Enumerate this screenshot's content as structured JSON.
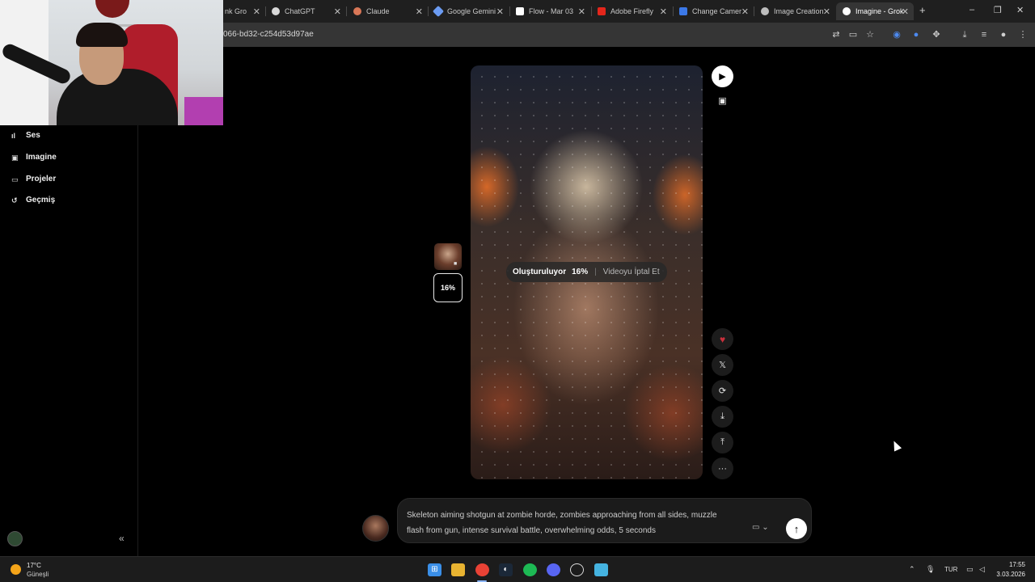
{
  "browser": {
    "tabs": [
      {
        "title": "nk Gro",
        "icon": "grok-icon",
        "color": "#9e9e9e"
      },
      {
        "title": "ChatGPT",
        "icon": "chatgpt-icon",
        "color": "#d9d9d9"
      },
      {
        "title": "Claude",
        "icon": "claude-icon",
        "color": "#d97757"
      },
      {
        "title": "Google Gemini",
        "icon": "gemini-icon",
        "color": "#6b9bf2"
      },
      {
        "title": "Flow - Mar 03",
        "icon": "flow-icon",
        "color": "#ffffff"
      },
      {
        "title": "Adobe Firefly",
        "icon": "firefly-icon",
        "color": "#e4261b"
      },
      {
        "title": "Change Camer",
        "icon": "docs-icon",
        "color": "#3b78e7"
      },
      {
        "title": "Image Creation",
        "icon": "grok-icon",
        "color": "#bdbdbd"
      },
      {
        "title": "Imagine - Grok",
        "icon": "grok-icon",
        "color": "#ffffff"
      }
    ],
    "active_tab": 8,
    "url": "066-bd32-c254d53d97ae",
    "new_tab_symbol": "+",
    "window_controls": [
      "–",
      "❐",
      "✕"
    ]
  },
  "sidebar": {
    "items": [
      {
        "label": "Ses",
        "icon": "audio-waveform-icon"
      },
      {
        "label": "Imagine",
        "icon": "imagine-icon"
      },
      {
        "label": "Projeler",
        "icon": "folder-icon"
      },
      {
        "label": "Geçmiş",
        "icon": "history-icon"
      }
    ],
    "collapse_symbol": "«"
  },
  "generation": {
    "status_label": "Oluşturuluyor",
    "progress": "16%",
    "progress_fraction": 0.16,
    "cancel_label": "Videoyu İptal Et",
    "thumbnail_progress": "16%"
  },
  "actions": [
    {
      "name": "video-mode-icon",
      "glyph": "▶"
    },
    {
      "name": "image-mode-icon",
      "glyph": "▣"
    },
    {
      "name": "heart-icon",
      "glyph": "♥"
    },
    {
      "name": "x-share-icon",
      "glyph": "𝕏"
    },
    {
      "name": "remix-icon",
      "glyph": "⟳"
    },
    {
      "name": "download-icon",
      "glyph": "⤓"
    },
    {
      "name": "share-icon",
      "glyph": "⤒"
    },
    {
      "name": "more-icon",
      "glyph": "···"
    }
  ],
  "prompt": {
    "text": "Skeleton aiming shotgun at zombie horde, zombies approaching from all sides, muzzle flash from gun, intense survival battle, overwhelming odds, 5 seconds",
    "mode_glyph": "▭ ⌄",
    "send_glyph": "↑"
  },
  "taskbar": {
    "weather_temp": "17°C",
    "weather_desc": "Güneşli",
    "language": "TUR",
    "time": "17:55",
    "date": "3.03.2026"
  }
}
